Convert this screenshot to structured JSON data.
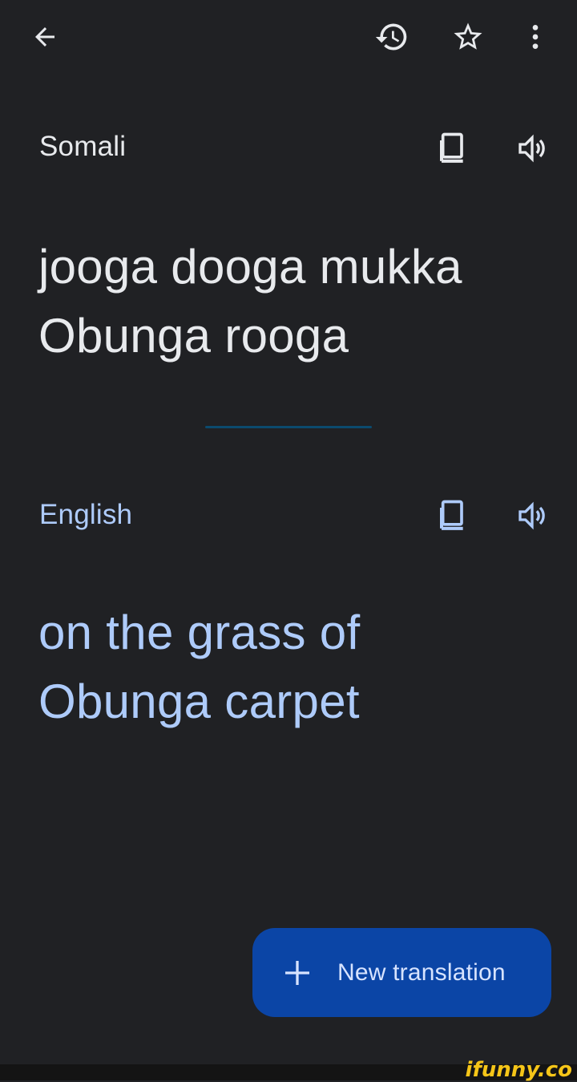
{
  "toolbar": {
    "back_icon": "arrow-back-icon",
    "history_icon": "history-icon",
    "star_icon": "star-outline-icon",
    "more_icon": "more-vert-icon"
  },
  "source": {
    "language": "Somali",
    "lines": [
      "jooga dooga mukka",
      "Obunga rooga"
    ],
    "copy_icon": "copy-icon",
    "speak_icon": "volume-icon"
  },
  "target": {
    "language": "English",
    "lines": [
      "on the grass of",
      "Obunga carpet"
    ],
    "copy_icon": "copy-icon",
    "speak_icon": "volume-icon"
  },
  "fab": {
    "label": "New translation",
    "icon": "plus-icon"
  },
  "watermark": "ifunny.co",
  "colors": {
    "background": "#202124",
    "source_text": "#e8eaed",
    "target_text": "#aecbfa",
    "fab_bg": "#0b45a6",
    "divider": "#0b4a6e"
  }
}
